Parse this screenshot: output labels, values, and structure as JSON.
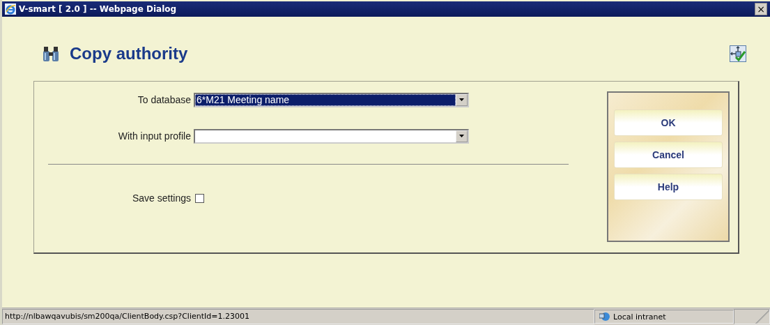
{
  "window": {
    "title": "V-smart [ 2.0 ] -- Webpage Dialog",
    "close": "×"
  },
  "heading": "Copy authority",
  "fields": [
    {
      "label": "To database",
      "value": "6*M21 Meeting name",
      "highlighted": true
    },
    {
      "label": "With input profile",
      "highlighted": false
    }
  ],
  "save_settings": {
    "label": "Save settings",
    "checked": false
  },
  "buttons": [
    "OK",
    "Cancel",
    "Help"
  ],
  "status_bar": {
    "url": "http://nlbawqavubis/sm200qa/ClientBody.csp?ClientId=1.23001",
    "zone": "Local intranet"
  }
}
